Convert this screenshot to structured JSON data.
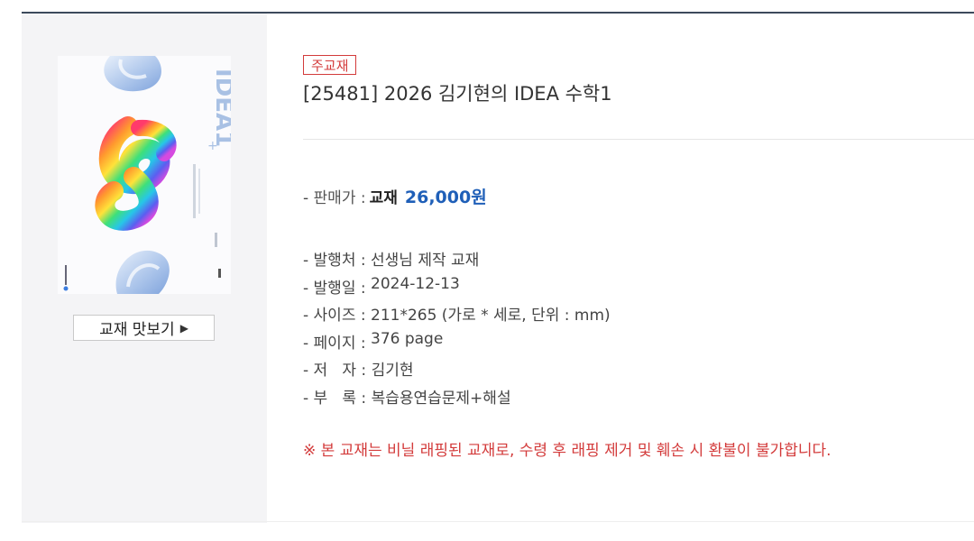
{
  "product": {
    "badge": "주교재",
    "title": "[25481] 2026 김기현의 IDEA 수학1",
    "preview_label": "교재 맛보기",
    "cover_text": "IDEA1",
    "cover_plus": "+"
  },
  "price": {
    "label": "판매가 :",
    "kind": "교재",
    "amount": "26,000원"
  },
  "info": [
    {
      "label": "- 발행처 : ",
      "value": "선생님 제작 교재"
    },
    {
      "label": "- 발행일 : ",
      "value": "2024-12-13"
    },
    {
      "label": "- 사이즈 : ",
      "value": "211*265 (가로 * 세로, 단위 : mm)"
    },
    {
      "label": "- 페이지 : ",
      "value": "376 page"
    },
    {
      "label": "- 저   자 : ",
      "value": "김기현"
    },
    {
      "label": "- 부   록 : ",
      "value": "복습용연습문제+해설"
    }
  ],
  "notice": "※ 본 교재는 비닐 래핑된 교재로, 수령 후 래핑 제거 및 훼손 시 환불이 불가합니다.",
  "colors": {
    "accent_red": "#d33b3b",
    "price_blue": "#1f5fb8",
    "top_rule": "#3c4a5c"
  }
}
